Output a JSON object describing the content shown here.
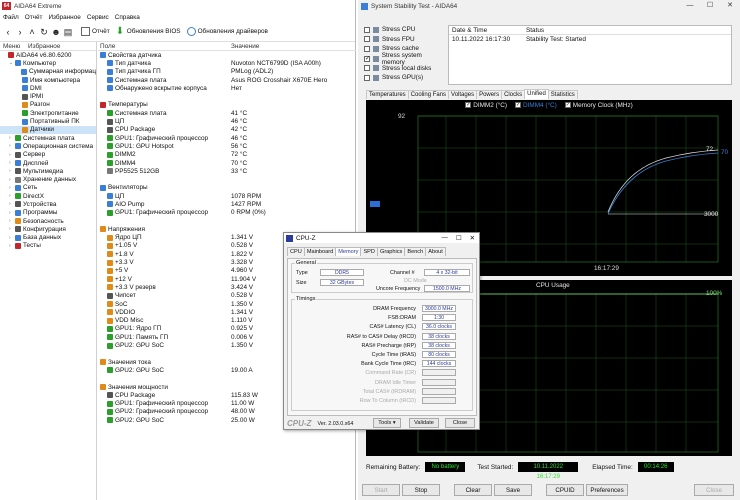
{
  "aida": {
    "title": "AIDA64 Extreme",
    "menu": [
      "Файл",
      "Отчёт",
      "Избранное",
      "Сервис",
      "Справка"
    ],
    "toolbar": {
      "report": "Отчёт",
      "bios": "Обновления BIOS",
      "drivers": "Обновления драйверов"
    },
    "tree_header": {
      "menu": "Меню",
      "fav": "Избранное"
    },
    "tree": [
      {
        "label": "AIDA64 v6.80.6200",
        "level": 0,
        "exp": "",
        "color": "#c2262b"
      },
      {
        "label": "Компьютер",
        "level": 1,
        "exp": "⌄",
        "color": "#3a7fd5"
      },
      {
        "label": "Суммарная информац",
        "level": 2,
        "exp": "",
        "color": "#3a7fd5"
      },
      {
        "label": "Имя компьютера",
        "level": 2,
        "exp": "",
        "color": "#3a7fd5"
      },
      {
        "label": "DMI",
        "level": 2,
        "exp": "",
        "color": "#3a7fd5"
      },
      {
        "label": "IPMI",
        "level": 2,
        "exp": "",
        "color": "#555"
      },
      {
        "label": "Разгон",
        "level": 2,
        "exp": "",
        "color": "#e08a1a"
      },
      {
        "label": "Электропитание",
        "level": 2,
        "exp": "",
        "color": "#2aa02a"
      },
      {
        "label": "Портативный ПК",
        "level": 2,
        "exp": "",
        "color": "#3a7fd5"
      },
      {
        "label": "Датчики",
        "level": 2,
        "exp": "",
        "color": "#e08a1a",
        "selected": true
      },
      {
        "label": "Системная плата",
        "level": 1,
        "exp": "›",
        "color": "#2aa02a"
      },
      {
        "label": "Операционная система",
        "level": 1,
        "exp": "›",
        "color": "#3a7fd5"
      },
      {
        "label": "Сервер",
        "level": 1,
        "exp": "›",
        "color": "#555"
      },
      {
        "label": "Дисплей",
        "level": 1,
        "exp": "›",
        "color": "#3a7fd5"
      },
      {
        "label": "Мультимедиа",
        "level": 1,
        "exp": "›",
        "color": "#555"
      },
      {
        "label": "Хранение данных",
        "level": 1,
        "exp": "›",
        "color": "#777"
      },
      {
        "label": "Сеть",
        "level": 1,
        "exp": "›",
        "color": "#3a7fd5"
      },
      {
        "label": "DirectX",
        "level": 1,
        "exp": "›",
        "color": "#2aa02a"
      },
      {
        "label": "Устройства",
        "level": 1,
        "exp": "›",
        "color": "#555"
      },
      {
        "label": "Программы",
        "level": 1,
        "exp": "›",
        "color": "#3a7fd5"
      },
      {
        "label": "Безопасность",
        "level": 1,
        "exp": "›",
        "color": "#e08a1a"
      },
      {
        "label": "Конфигурация",
        "level": 1,
        "exp": "›",
        "color": "#555"
      },
      {
        "label": "База данных",
        "level": 1,
        "exp": "›",
        "color": "#3a7fd5"
      },
      {
        "label": "Тесты",
        "level": 1,
        "exp": "›",
        "color": "#c2262b"
      }
    ],
    "detail_header": {
      "field": "Поле",
      "value": "Значение"
    },
    "rows": [
      {
        "field": "Свойства датчика",
        "value": "",
        "type": "section",
        "color": "#3a7fd5"
      },
      {
        "field": "Тип датчика",
        "value": "Nuvoton NCT6799D  (ISA A00h)",
        "color": "#3a7fd5"
      },
      {
        "field": "Тип датчика ГП",
        "value": "PMLog  (ADL2)",
        "color": "#3a7fd5"
      },
      {
        "field": "Системная плата",
        "value": "Asus ROG Crosshair X670E Hero",
        "color": "#3a7fd5"
      },
      {
        "field": "Обнаружено вскрытие корпуса",
        "value": "Нет",
        "color": "#3a7fd5"
      },
      {
        "field": "",
        "value": "",
        "type": "blank"
      },
      {
        "field": "Температуры",
        "value": "",
        "type": "section",
        "color": "#c2262b"
      },
      {
        "field": "Системная плата",
        "value": "41 °C",
        "color": "#2aa02a"
      },
      {
        "field": "ЦП",
        "value": "46 °C",
        "color": "#555"
      },
      {
        "field": "CPU Package",
        "value": "42 °C",
        "color": "#555"
      },
      {
        "field": "GPU1: Графический процессор",
        "value": "46 °C",
        "color": "#2aa02a"
      },
      {
        "field": "GPU1: GPU Hotspot",
        "value": "56 °C",
        "color": "#2aa02a"
      },
      {
        "field": "DIMM2",
        "value": "72 °C",
        "color": "#2aa02a"
      },
      {
        "field": "DIMM4",
        "value": "70 °C",
        "color": "#2aa02a"
      },
      {
        "field": "PP5525 512GB",
        "value": "33 °C",
        "color": "#777"
      },
      {
        "field": "",
        "value": "",
        "type": "blank"
      },
      {
        "field": "Вентиляторы",
        "value": "",
        "type": "section",
        "color": "#3a7fd5"
      },
      {
        "field": "ЦП",
        "value": "1078 RPM",
        "color": "#3a7fd5"
      },
      {
        "field": "AIO Pump",
        "value": "1427 RPM",
        "color": "#3a7fd5"
      },
      {
        "field": "GPU1: Графический процессор",
        "value": "0 RPM  (0%)",
        "color": "#2aa02a"
      },
      {
        "field": "",
        "value": "",
        "type": "blank"
      },
      {
        "field": "Напряжения",
        "value": "",
        "type": "section",
        "color": "#e08a1a"
      },
      {
        "field": "Ядро ЦП",
        "value": "1.341 V",
        "color": "#e08a1a"
      },
      {
        "field": "+1.05 V",
        "value": "0.528 V",
        "color": "#e08a1a"
      },
      {
        "field": "+1.8 V",
        "value": "1.822 V",
        "color": "#e08a1a"
      },
      {
        "field": "+3.3 V",
        "value": "3.328 V",
        "color": "#e08a1a"
      },
      {
        "field": "+5 V",
        "value": "4.960 V",
        "color": "#e08a1a"
      },
      {
        "field": "+12 V",
        "value": "11.904 V",
        "color": "#e08a1a"
      },
      {
        "field": "+3.3 V резерв",
        "value": "3.424 V",
        "color": "#e08a1a"
      },
      {
        "field": "Чипсет",
        "value": "0.528 V",
        "color": "#555"
      },
      {
        "field": "SoC",
        "value": "1.350 V",
        "color": "#e08a1a"
      },
      {
        "field": "VDDIO",
        "value": "1.341 V",
        "color": "#e08a1a"
      },
      {
        "field": "VDD Misc",
        "value": "1.110 V",
        "color": "#e08a1a"
      },
      {
        "field": "GPU1: Ядро ГП",
        "value": "0.925 V",
        "color": "#2aa02a"
      },
      {
        "field": "GPU1: Память ГП",
        "value": "0.006 V",
        "color": "#2aa02a"
      },
      {
        "field": "GPU2: GPU SoC",
        "value": "1.350 V",
        "color": "#2aa02a"
      },
      {
        "field": "",
        "value": "",
        "type": "blank"
      },
      {
        "field": "Значения тока",
        "value": "",
        "type": "section",
        "color": "#e08a1a"
      },
      {
        "field": "GPU2: GPU SoC",
        "value": "19.00 A",
        "color": "#2aa02a"
      },
      {
        "field": "",
        "value": "",
        "type": "blank"
      },
      {
        "field": "Значения мощности",
        "value": "",
        "type": "section",
        "color": "#e08a1a"
      },
      {
        "field": "CPU Package",
        "value": "115.83 W",
        "color": "#555"
      },
      {
        "field": "GPU1: Графический процессор",
        "value": "11.00 W",
        "color": "#2aa02a"
      },
      {
        "field": "GPU2: Графический процессор",
        "value": "48.00 W",
        "color": "#2aa02a"
      },
      {
        "field": "GPU2: GPU SoC",
        "value": "25.00 W",
        "color": "#2aa02a"
      }
    ]
  },
  "sst": {
    "title": "System Stability Test - AIDA64",
    "stress": [
      {
        "label": "Stress CPU",
        "checked": false
      },
      {
        "label": "Stress FPU",
        "checked": false
      },
      {
        "label": "Stress cache",
        "checked": false
      },
      {
        "label": "Stress system memory",
        "checked": true
      },
      {
        "label": "Stress local disks",
        "checked": false
      },
      {
        "label": "Stress GPU(s)",
        "checked": false
      }
    ],
    "status_table": {
      "col_date": "Date & Time",
      "col_status": "Status",
      "date": "10.11.2022 16:17:30",
      "status": "Stability Test: Started"
    },
    "tabs": [
      "Temperatures",
      "Cooling Fans",
      "Voltages",
      "Powers",
      "Clocks",
      "Unified",
      "Statistics"
    ],
    "active_tab": "Unified",
    "legend": [
      "DIMM2 (°C)",
      "DIMM4 (°C)",
      "Memory Clock (MHz)"
    ],
    "graph1": {
      "ymax": "92",
      "ymin": "0",
      "right_labels": [
        "72",
        "70"
      ],
      "clock_label": "3000",
      "time": "16:17:29"
    },
    "graph2": {
      "title": "CPU Usage",
      "top": "100%",
      "bottom": "0%"
    },
    "battery_label": "Remaining Battery:",
    "battery_value": "No battery",
    "started_label": "Test Started:",
    "started_value": "10.11.2022 16:17:29",
    "elapsed_label": "Elapsed Time:",
    "elapsed_value": "00:14:26",
    "buttons": {
      "start": "Start",
      "stop": "Stop",
      "clear": "Clear",
      "save": "Save",
      "cpuid": "CPUID",
      "prefs": "Preferences",
      "close": "Close"
    }
  },
  "cpuz": {
    "title": "CPU-Z",
    "tabs": [
      "CPU",
      "Mainboard",
      "Memory",
      "SPD",
      "Graphics",
      "Bench",
      "About"
    ],
    "active_tab": "Memory",
    "general": {
      "title": "General",
      "type_label": "Type",
      "type": "DDR5",
      "size_label": "Size",
      "size": "32 GBytes",
      "channel_label": "Channel #",
      "channel": "4 x 32-bit",
      "dcmode_label": "DC Mode",
      "uncore_label": "Uncore Frequency",
      "uncore": "1500.0 MHz"
    },
    "timings": {
      "title": "Timings",
      "rows": [
        {
          "label": "DRAM Frequency",
          "value": "3000.0 MHz"
        },
        {
          "label": "FSB:DRAM",
          "value": "1:30"
        },
        {
          "label": "CAS# Latency (CL)",
          "value": "36.0 clocks"
        },
        {
          "label": "RAS# to CAS# Delay (tRCD)",
          "value": "38 clocks"
        },
        {
          "label": "RAS# Precharge (tRP)",
          "value": "38 clocks"
        },
        {
          "label": "Cycle Time (tRAS)",
          "value": "80 clocks"
        },
        {
          "label": "Bank Cycle Time (tRC)",
          "value": "144 clocks"
        },
        {
          "label": "Command Rate (CR)",
          "value": "",
          "disabled": true
        },
        {
          "label": "DRAM Idle Timer",
          "value": "",
          "disabled": true
        },
        {
          "label": "Total CAS# (tRDRAM)",
          "value": "",
          "disabled": true
        },
        {
          "label": "Row To Column (tRCD)",
          "value": "",
          "disabled": true
        }
      ]
    },
    "logo": "CPU-Z",
    "version": "Ver. 2.03.0.x64",
    "tools": "Tools",
    "validate": "Validate",
    "close": "Close"
  }
}
